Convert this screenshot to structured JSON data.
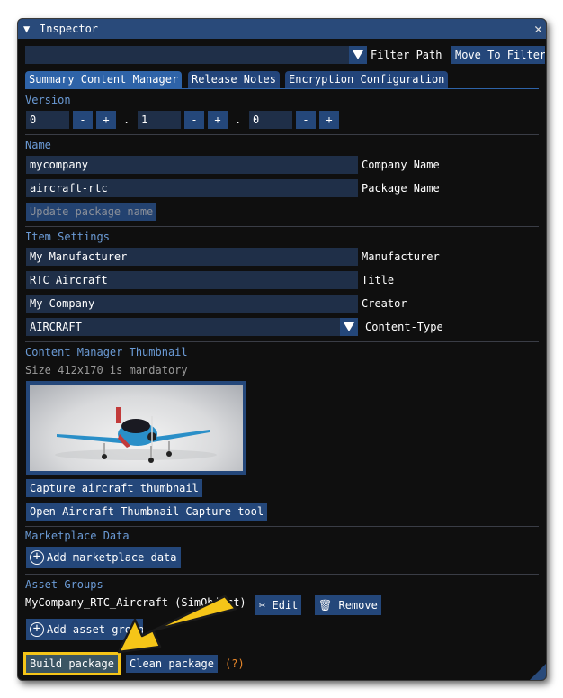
{
  "window": {
    "title": "Inspector"
  },
  "filter": {
    "path_value": "",
    "filter_label": "Filter Path",
    "move_button": "Move To Filter"
  },
  "tabs": [
    {
      "label": "Summary Content Manager",
      "active": true
    },
    {
      "label": "Release Notes",
      "active": false
    },
    {
      "label": "Encryption Configuration",
      "active": false
    }
  ],
  "version": {
    "heading": "Version",
    "major": "0",
    "minor": "1",
    "patch": "0",
    "minus": "-",
    "plus": "+",
    "dot": "."
  },
  "name": {
    "heading": "Name",
    "company_value": "mycompany",
    "company_label": "Company Name",
    "package_value": "aircraft-rtc",
    "package_label": "Package Name",
    "update_button": "Update package name"
  },
  "item_settings": {
    "heading": "Item Settings",
    "manufacturer_value": "My Manufacturer",
    "manufacturer_label": "Manufacturer",
    "title_value": "RTC Aircraft",
    "title_label": "Title",
    "creator_value": "My Company",
    "creator_label": "Creator",
    "content_type_value": "AIRCRAFT",
    "content_type_label": "Content-Type"
  },
  "thumbnail": {
    "heading": "Content Manager Thumbnail",
    "note": "Size 412x170 is mandatory",
    "capture_button": "Capture aircraft thumbnail",
    "open_tool_button": "Open Aircraft Thumbnail Capture tool"
  },
  "marketplace": {
    "heading": "Marketplace Data",
    "add_button": "Add marketplace data"
  },
  "asset_groups": {
    "heading": "Asset Groups",
    "group_name": "MyCompany_RTC_Aircraft (SimObject)",
    "edit_button": "Edit",
    "remove_button": "Remove",
    "add_button": "Add asset group"
  },
  "footer": {
    "build_button": "Build package",
    "clean_button": "Clean package",
    "help": "(?)"
  },
  "colors": {
    "accent": "#24477a",
    "heading": "#6b9bd6",
    "help": "#e8872a",
    "highlight": "#f5c518"
  }
}
